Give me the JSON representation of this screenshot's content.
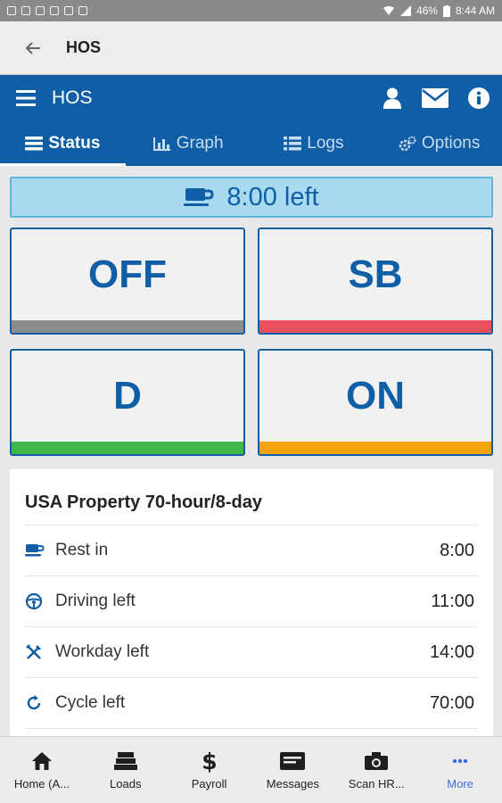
{
  "status_bar": {
    "battery": "46%",
    "time": "8:44 AM"
  },
  "app_header": {
    "title": "HOS"
  },
  "toolbar": {
    "title": "HOS"
  },
  "tabs": [
    {
      "label": "Status",
      "active": true
    },
    {
      "label": "Graph",
      "active": false
    },
    {
      "label": "Logs",
      "active": false
    },
    {
      "label": "Options",
      "active": false
    }
  ],
  "banner": {
    "text": "8:00 left"
  },
  "status_buttons": [
    {
      "label": "OFF",
      "color": "#8c8c8c"
    },
    {
      "label": "SB",
      "color": "#e8505b"
    },
    {
      "label": "D",
      "color": "#3fb54a"
    },
    {
      "label": "ON",
      "color": "#f5a30f"
    }
  ],
  "summary": {
    "title": "USA Property 70-hour/8-day",
    "rows": [
      {
        "label": "Rest in",
        "value": "8:00",
        "icon": "coffee-icon"
      },
      {
        "label": "Driving left",
        "value": "11:00",
        "icon": "steering-wheel-icon"
      },
      {
        "label": "Workday left",
        "value": "14:00",
        "icon": "tools-icon"
      },
      {
        "label": "Cycle left",
        "value": "70:00",
        "icon": "refresh-icon"
      }
    ]
  },
  "bottom_nav": [
    {
      "label": "Home (A...",
      "icon": "home-icon"
    },
    {
      "label": "Loads",
      "icon": "loads-icon"
    },
    {
      "label": "Payroll",
      "icon": "dollar-icon"
    },
    {
      "label": "Messages",
      "icon": "messages-icon"
    },
    {
      "label": "Scan HR...",
      "icon": "camera-icon"
    },
    {
      "label": "More",
      "icon": "more-icon",
      "active": true
    }
  ],
  "colors": {
    "primary": "#0f5ea6",
    "banner_bg": "#a9d9ef",
    "active_nav": "#3d6fd8"
  }
}
